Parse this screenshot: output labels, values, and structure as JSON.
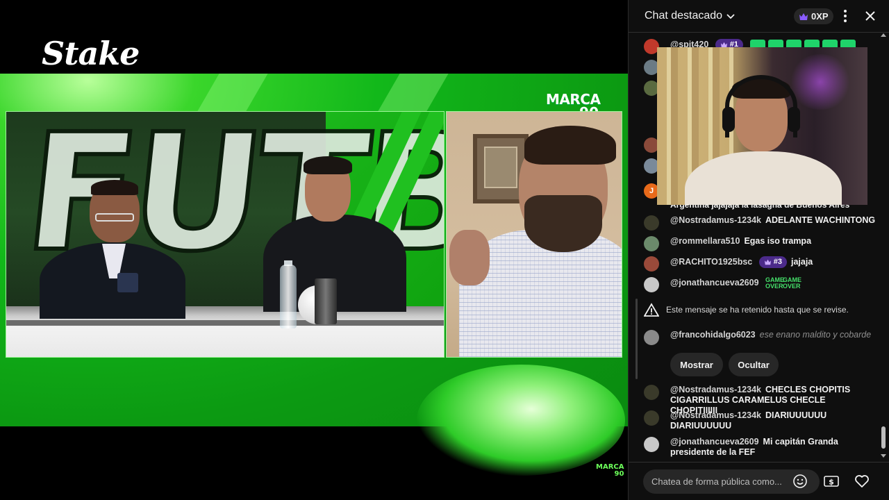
{
  "video": {
    "sponsor_logo": "Stake",
    "channel_logo_line1": "MARCA",
    "channel_logo_line2": "90",
    "watermark_line1": "MARCA",
    "watermark_line2": "90",
    "studio_backdrop_text": "FUTBOL",
    "colors": {
      "band": "#12b81a",
      "accent": "#3ad62b"
    }
  },
  "chat": {
    "title": "Chat destacado",
    "xp_label": "0XP",
    "messages": [
      {
        "user": "@spit420",
        "badge": "#1",
        "text": "",
        "emotes": 6
      },
      {
        "user": "@Nostradamus-1234k",
        "text": "ADELANTE WACHINTONG"
      },
      {
        "user": "@rommellara510",
        "text": "Egas iso trampa"
      },
      {
        "user": "@RACHITO1925bsc",
        "badge": "#3",
        "text": "jajaja"
      },
      {
        "user": "@jonathancueva2609",
        "text": "",
        "emote_text_1": "GAME OVER",
        "emote_text_2": "GAME OVER"
      },
      {
        "user": "@francohidalgo6023",
        "text": "ese enano maldito y cobarde"
      },
      {
        "user": "@Nostradamus-1234k",
        "text": "CHECLES CHOPITIS CIGARRILLUS CARAMELUS CHECLE CHOPITIIIIII"
      },
      {
        "user": "@Nostradamus-1234k",
        "text": "DIARIUUUUUU DIARIUUUUUU"
      },
      {
        "user": "@jonathancueva2609",
        "text": "Mi capitán Granda presidente de la FEF"
      }
    ],
    "partial_text": "Argentina jajajaja la lasagna de Buenos Aires",
    "held_notice": "Este mensaje se ha retenido hasta que se revise.",
    "show_button": "Mostrar",
    "hide_button": "Ocultar",
    "input_placeholder": "Chatea de forma pública como...",
    "avatar_initial": "J"
  }
}
